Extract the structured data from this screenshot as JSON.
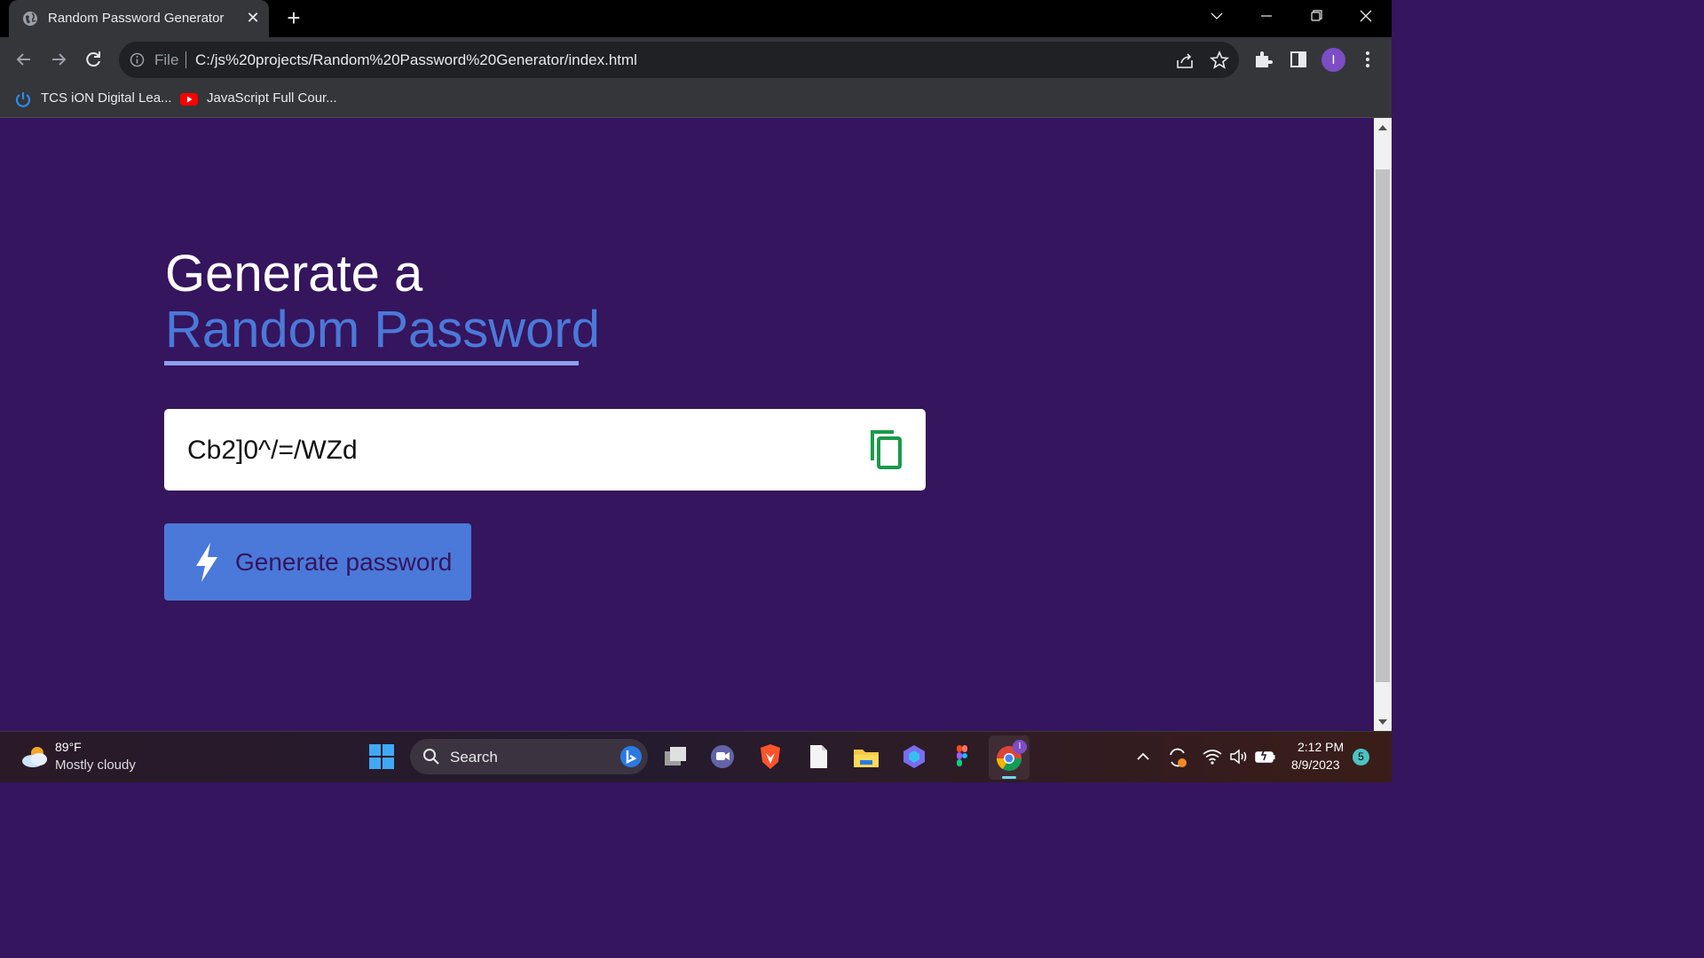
{
  "browser": {
    "tab_title": "Random Password Generator",
    "tab_close": "✕",
    "new_tab": "+",
    "address_scheme": "File",
    "address_url": "C:/js%20projects/Random%20Password%20Generator/index.html",
    "bookmarks": [
      {
        "label": "TCS iON Digital Lea...",
        "icon": "power-icon"
      },
      {
        "label": "JavaScript Full Cour...",
        "icon": "youtube-icon"
      }
    ],
    "profile_initial": "I"
  },
  "page": {
    "heading_line1": "Generate a",
    "heading_line2": "Random Password",
    "password_value": "Cb2]0^/=/WZd",
    "generate_label": "Generate password"
  },
  "taskbar": {
    "weather_temp": "89°F",
    "weather_condition": "Mostly cloudy",
    "search_label": "Search",
    "time": "2:12 PM",
    "date": "8/9/2023",
    "notification_count": "5",
    "chrome_badge": "I"
  },
  "colors": {
    "page_bg": "#35155d",
    "accent_blue": "#4a79d9",
    "underline": "#8c9ef0",
    "copy_icon_green": "#1a9a4a"
  }
}
